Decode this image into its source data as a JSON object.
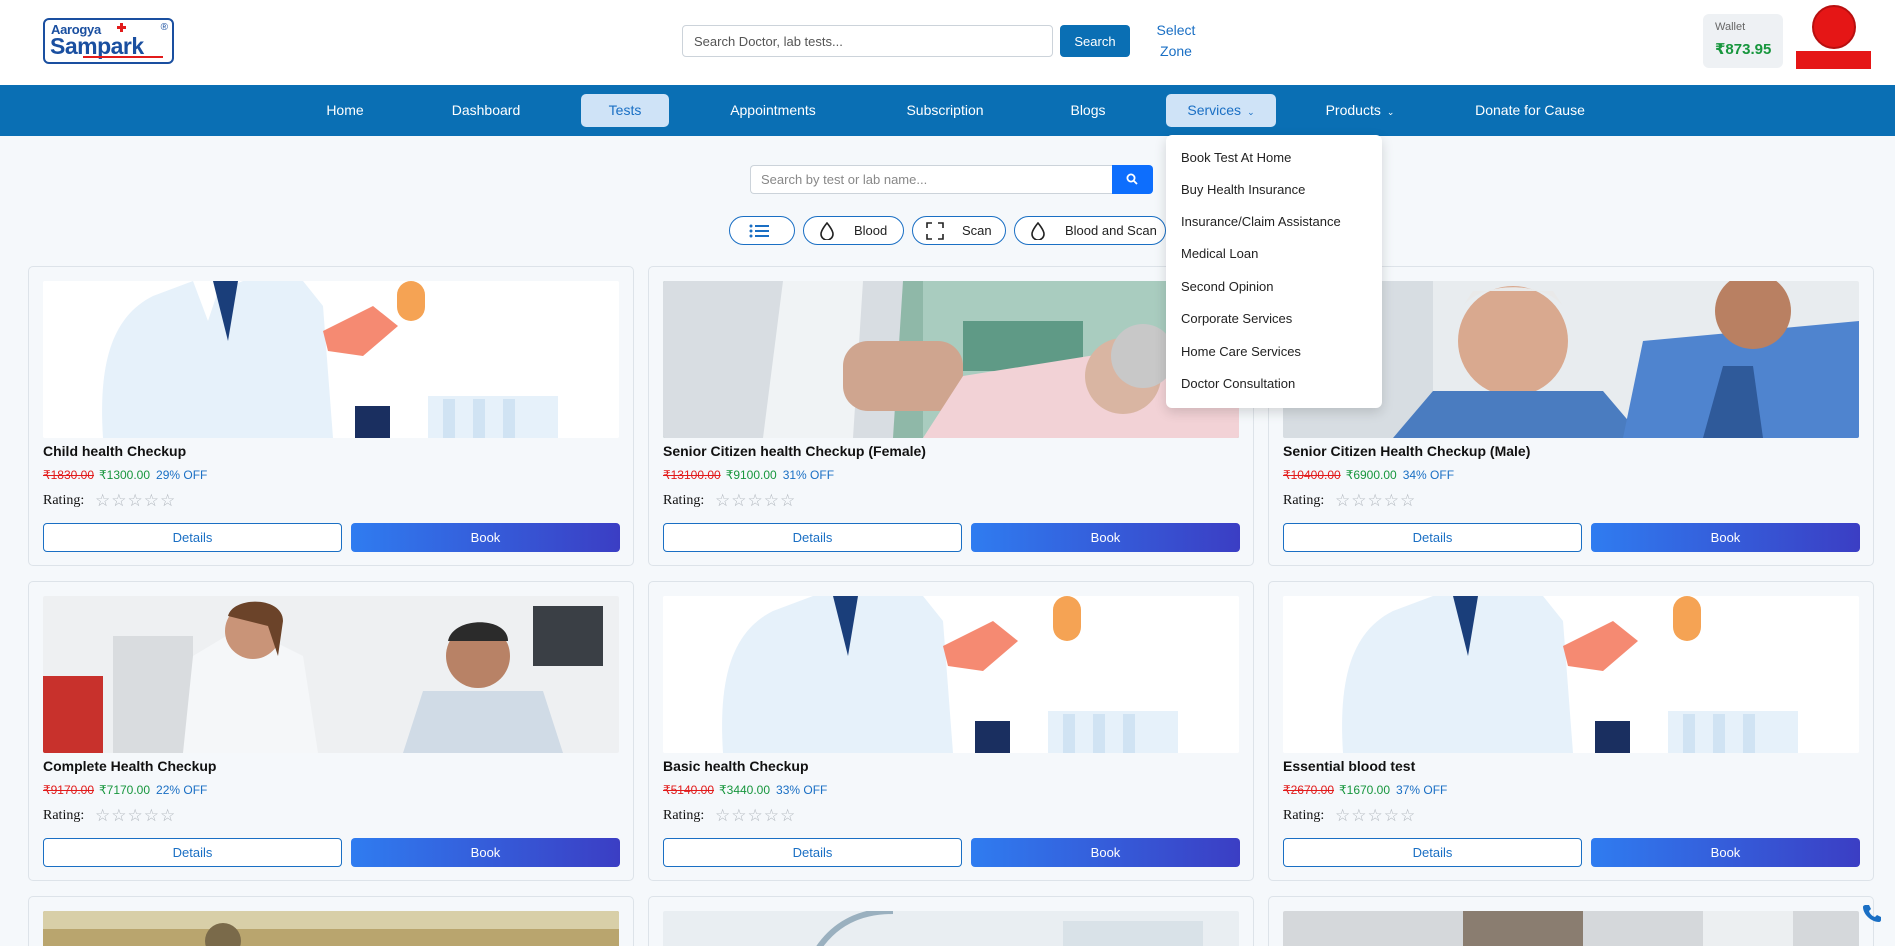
{
  "header": {
    "logo_line1": "Aarogya",
    "logo_line2": "Sampark",
    "logo_reg": "®",
    "search_placeholder": "Search Doctor, lab tests...",
    "search_button": "Search",
    "zone_line1": "Select",
    "zone_line2": "Zone",
    "wallet_label": "Wallet",
    "wallet_value": "₹873.95"
  },
  "nav": {
    "items": [
      "Home",
      "Dashboard",
      "Tests",
      "Appointments",
      "Subscription",
      "Blogs",
      "Services",
      "Products",
      "Donate for Cause"
    ],
    "active": "Tests"
  },
  "services_menu": [
    "Book Test At Home",
    "Buy Health Insurance",
    "Insurance/Claim Assistance",
    "Medical Loan",
    "Second Opinion",
    "Corporate Services",
    "Home Care Services",
    "Doctor Consultation"
  ],
  "lab_search": {
    "placeholder": "Search by test or lab name..."
  },
  "filters": [
    "Blood",
    "Scan",
    "Blood and Scan"
  ],
  "cards": [
    {
      "title": "Child health Checkup",
      "old_price": "₹1830.00",
      "new_price": "₹1300.00",
      "discount": "29% OFF",
      "rating_label": "Rating:",
      "details": "Details",
      "book": "Book",
      "image": "doctor-illustration"
    },
    {
      "title": "Senior Citizen health Checkup (Female)",
      "old_price": "₹13100.00",
      "new_price": "₹9100.00",
      "discount": "31% OFF",
      "rating_label": "Rating:",
      "details": "Details",
      "book": "Book",
      "image": "senior-female-photo"
    },
    {
      "title": "Senior Citizen Health Checkup (Male)",
      "old_price": "₹10400.00",
      "new_price": "₹6900.00",
      "discount": "34% OFF",
      "rating_label": "Rating:",
      "details": "Details",
      "book": "Book",
      "image": "senior-male-photo"
    },
    {
      "title": "Complete Health Checkup",
      "old_price": "₹9170.00",
      "new_price": "₹7170.00",
      "discount": "22% OFF",
      "rating_label": "Rating:",
      "details": "Details",
      "book": "Book",
      "image": "doctor-patient-photo"
    },
    {
      "title": "Basic health Checkup",
      "old_price": "₹5140.00",
      "new_price": "₹3440.00",
      "discount": "33% OFF",
      "rating_label": "Rating:",
      "details": "Details",
      "book": "Book",
      "image": "doctor-illustration"
    },
    {
      "title": "Essential blood test",
      "old_price": "₹2670.00",
      "new_price": "₹1670.00",
      "discount": "37% OFF",
      "rating_label": "Rating:",
      "details": "Details",
      "book": "Book",
      "image": "doctor-illustration"
    }
  ],
  "stars": "☆☆☆☆☆",
  "colors": {
    "primary": "#0a6fb4",
    "accent": "#1a6fc4",
    "price_old": "#e21b1b",
    "price_new": "#17963d"
  }
}
